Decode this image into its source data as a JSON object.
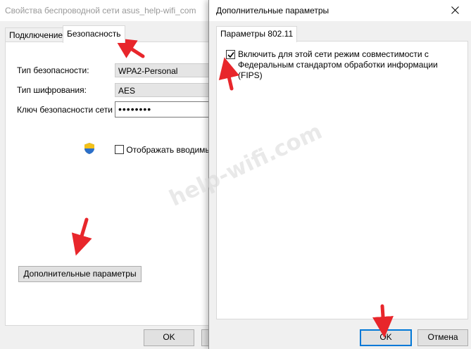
{
  "back_window": {
    "title": "Свойства беспроводной сети asus_help-wifi_com",
    "tabs": [
      {
        "label": "Подключение",
        "active": false
      },
      {
        "label": "Безопасность",
        "active": true
      }
    ],
    "security_type_label": "Тип безопасности:",
    "security_type_value": "WPA2-Personal",
    "encryption_type_label": "Тип шифрования:",
    "encryption_type_value": "AES",
    "network_key_label": "Ключ безопасности сети",
    "network_key_value": "••••••••",
    "show_chars_label": "Отображать вводимые",
    "show_chars_checked": false,
    "advanced_button": "Дополнительные параметры",
    "ok_button": "OK"
  },
  "dialog": {
    "title": "Дополнительные параметры",
    "tab_label": "Параметры 802.11",
    "fips_label": "Включить для этой сети режим совместимости с Федеральным стандартом обработки информации (FIPS)",
    "fips_checked": true,
    "ok_button": "OK",
    "cancel_button": "Отмена",
    "close_icon": "close-icon"
  },
  "watermark": "help-wifi.com",
  "colors": {
    "annotation_arrow": "#e8262b",
    "default_button_border": "#0078d7",
    "watermark": "#d7d7d7"
  }
}
